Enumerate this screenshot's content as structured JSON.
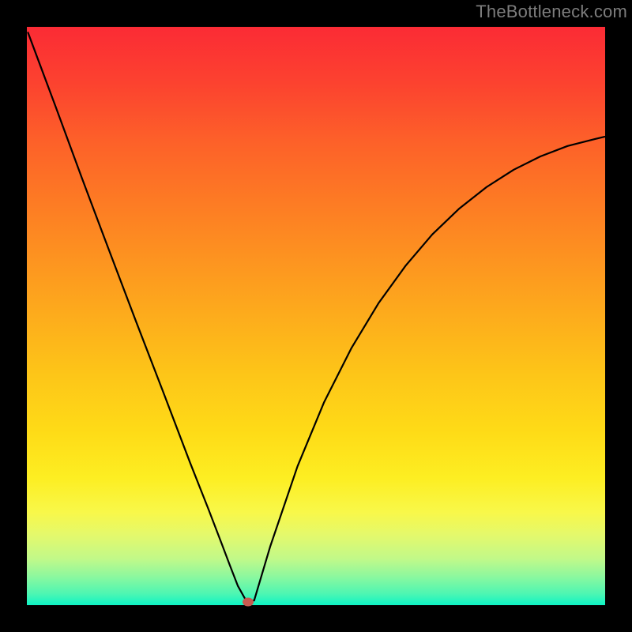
{
  "watermark": "TheBottleneck.com",
  "colors": {
    "curve": "#000000",
    "marker": "#c85a50",
    "frame": "#000000"
  },
  "chart_data": {
    "type": "line",
    "title": "",
    "xlabel": "",
    "ylabel": "",
    "xlim": [
      0,
      100
    ],
    "ylim": [
      0,
      100
    ],
    "x": [
      0.2,
      4.9,
      9.5,
      14.2,
      18.9,
      23.6,
      28.2,
      31.4,
      33.7,
      35.1,
      36.5,
      37.9,
      39.3,
      42.1,
      46.8,
      51.4,
      56.1,
      60.8,
      65.5,
      70.1,
      74.8,
      79.5,
      84.2,
      88.8,
      93.5,
      98.2,
      99.9
    ],
    "values": [
      99.0,
      86.4,
      73.9,
      61.4,
      49.0,
      36.8,
      24.7,
      16.6,
      10.6,
      6.9,
      3.3,
      0.8,
      0.8,
      10.2,
      24.0,
      35.1,
      44.4,
      52.2,
      58.7,
      64.1,
      68.6,
      72.3,
      75.3,
      77.6,
      79.4,
      80.6,
      81.0
    ],
    "marker": {
      "x": 38.3,
      "y": 0.5
    },
    "grid": false,
    "legend_position": "none"
  }
}
